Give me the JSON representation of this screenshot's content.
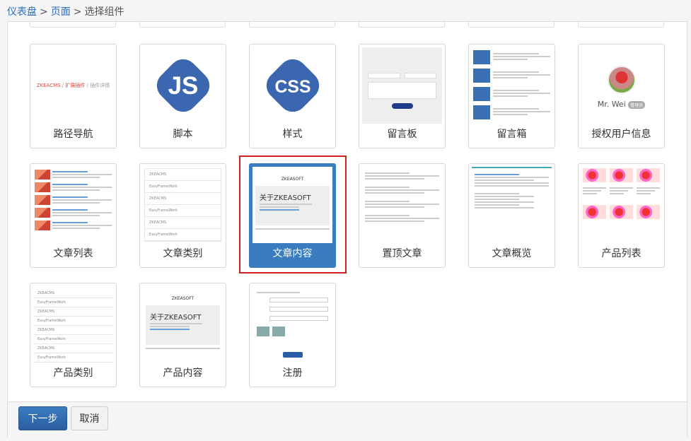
{
  "breadcrumb": {
    "items": [
      "仪表盘",
      "页面"
    ],
    "separator": ">",
    "current": "选择组件"
  },
  "thumbs": {
    "breadcrumb_text": "ZKEACMS",
    "breadcrumb_mid": "扩展插件",
    "breadcrumb_last": "插件详情",
    "js_text": "JS",
    "css_text": "CSS",
    "user_name": "Mr. Wei",
    "user_tag": "管理员",
    "article_brand": "ZKEASOFT",
    "article_hero": "关于ZKEASOFT",
    "product_brand": "ZKEASOFT",
    "product_hero": "关于ZKEASOFT",
    "cat_rows_a": [
      "ZKEACMS",
      "EasyFrameWork",
      "ZKEACMS",
      "EasyFrameWork",
      "ZKEACMS",
      "EasyFrameWork",
      "ZKEACMS"
    ],
    "cat_rows_b": [
      "ZKEACMS",
      "EasyFrameWork",
      "ZKEACMS",
      "EasyFrameWork",
      "ZKEACMS",
      "EasyFrameWork",
      "ZKEACMS",
      "EasyFrameWork"
    ]
  },
  "components": [
    {
      "label": "路径导航"
    },
    {
      "label": "脚本"
    },
    {
      "label": "样式"
    },
    {
      "label": "留言板"
    },
    {
      "label": "留言箱"
    },
    {
      "label": "授权用户信息"
    },
    {
      "label": "文章列表"
    },
    {
      "label": "文章类别"
    },
    {
      "label": "文章内容"
    },
    {
      "label": "置顶文章"
    },
    {
      "label": "文章概览"
    },
    {
      "label": "产品列表"
    },
    {
      "label": "产品类别"
    },
    {
      "label": "产品内容"
    },
    {
      "label": "注册"
    }
  ],
  "selected_index": 8,
  "footer": {
    "next_label": "下一步",
    "cancel_label": "取消"
  },
  "colors": {
    "accent": "#3a7cc0",
    "link": "#2a6ebd",
    "selection_frame": "#d02020"
  }
}
